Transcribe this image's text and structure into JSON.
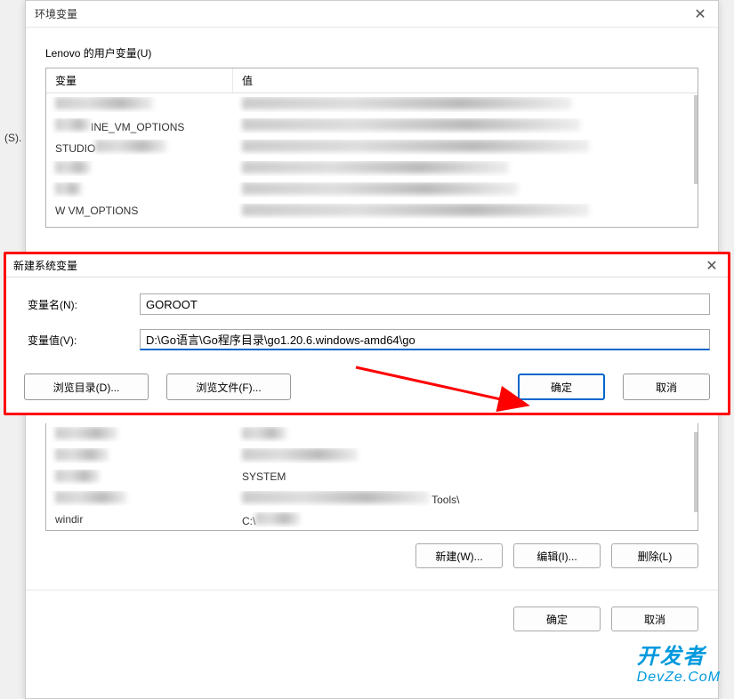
{
  "mainDialog": {
    "title": "环境变量",
    "sectionLabel": "Lenovo 的用户变量(U)",
    "columns": {
      "variable": "变量",
      "value": "值"
    },
    "userRows": [
      {
        "var": "",
        "val": ""
      },
      {
        "var": "INE_VM_OPTIONS",
        "val": ""
      },
      {
        "var": "STUDIO",
        "val": ""
      },
      {
        "var": "",
        "val": ""
      },
      {
        "var": "",
        "val": ""
      },
      {
        "var": "W           VM_OPTIONS",
        "val": ""
      }
    ],
    "sysRows": [
      {
        "var": "",
        "val": ""
      },
      {
        "var": "",
        "val": ""
      },
      {
        "var": "",
        "val": "SYSTEM"
      },
      {
        "var": "",
        "val": "Tools\\"
      },
      {
        "var": "windir",
        "val": "C:\\"
      }
    ],
    "buttons": {
      "new": "新建(W)...",
      "edit": "编辑(I)...",
      "delete": "删除(L)",
      "ok": "确定",
      "cancel": "取消"
    }
  },
  "newVarDialog": {
    "title": "新建系统变量",
    "labels": {
      "name": "变量名(N):",
      "value": "变量值(V):"
    },
    "fields": {
      "name": "GOROOT",
      "value": "D:\\Go语言\\Go程序目录\\go1.20.6.windows-amd64\\go"
    },
    "buttons": {
      "browseDir": "浏览目录(D)...",
      "browseFile": "浏览文件(F)...",
      "ok": "确定",
      "cancel": "取消"
    }
  },
  "leftEdge": "(S).",
  "watermark": {
    "top": "开发者",
    "bottom": "DevZe.CoM"
  }
}
